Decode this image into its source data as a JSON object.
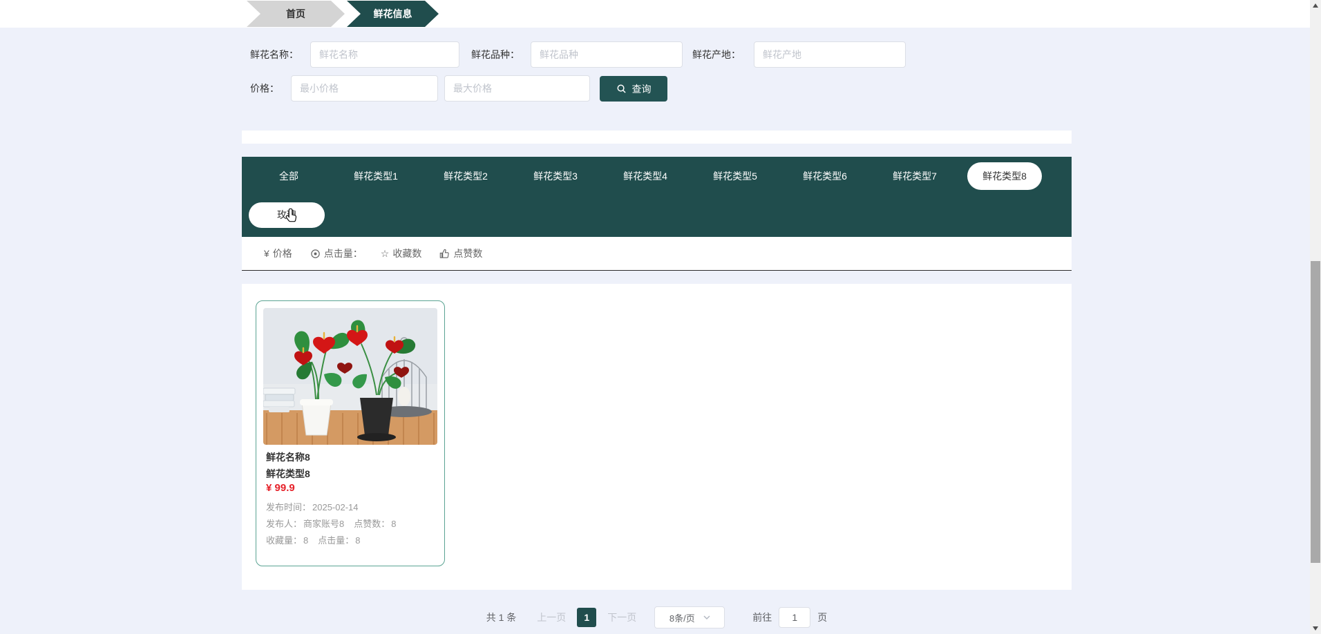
{
  "breadcrumb": {
    "home": "首页",
    "current": "鲜花信息"
  },
  "search_form": {
    "fields": [
      {
        "label": "鲜花名称：",
        "placeholder": "鲜花名称"
      },
      {
        "label": "鲜花品种：",
        "placeholder": "鲜花品种"
      },
      {
        "label": "鲜花产地：",
        "placeholder": "鲜花产地"
      }
    ],
    "price": {
      "label": "价格：",
      "min_placeholder": "最小价格",
      "max_placeholder": "最大价格"
    },
    "search_button": "查询"
  },
  "category_tabs": {
    "items": [
      "全部",
      "鲜花类型1",
      "鲜花类型2",
      "鲜花类型3",
      "鲜花类型4",
      "鲜花类型5",
      "鲜花类型6",
      "鲜花类型7",
      "鲜花类型8"
    ],
    "selected": "鲜花类型8",
    "sub_tag": "玫瑰"
  },
  "sort_bar": {
    "price": {
      "glyph": "¥",
      "label": "价格"
    },
    "clicks": {
      "label": "点击量："
    },
    "favorites": {
      "glyph": "☆",
      "label": "收藏数"
    },
    "likes": {
      "label": "点赞数"
    }
  },
  "products": [
    {
      "name": "鲜花名称8",
      "type": "鲜花类型8",
      "price": "¥ 99.9",
      "publish_time_label": "发布时间：",
      "publish_time": "2025-02-14",
      "publisher_label": "发布人：",
      "publisher": "商家账号8",
      "likes_label": "点赞数：",
      "likes": "8",
      "favorites_label": "收藏量：",
      "favorites": "8",
      "clicks_label": "点击量：",
      "clicks": "8"
    }
  ],
  "pagination": {
    "total": "共 1 条",
    "prev": "上一页",
    "active_page": "1",
    "next": "下一页",
    "page_size": "8条/页",
    "goto_label": "前往",
    "goto_value": "1",
    "goto_suffix": "页"
  },
  "colors": {
    "accent_teal": "#204d4d",
    "page_background": "#eef1fa",
    "breadcrumb_gray": "#d4d4d4",
    "card_border": "#5aa392",
    "price_red": "#e62129",
    "disabled_text": "#c0c4cc",
    "meta_text": "#999999"
  }
}
